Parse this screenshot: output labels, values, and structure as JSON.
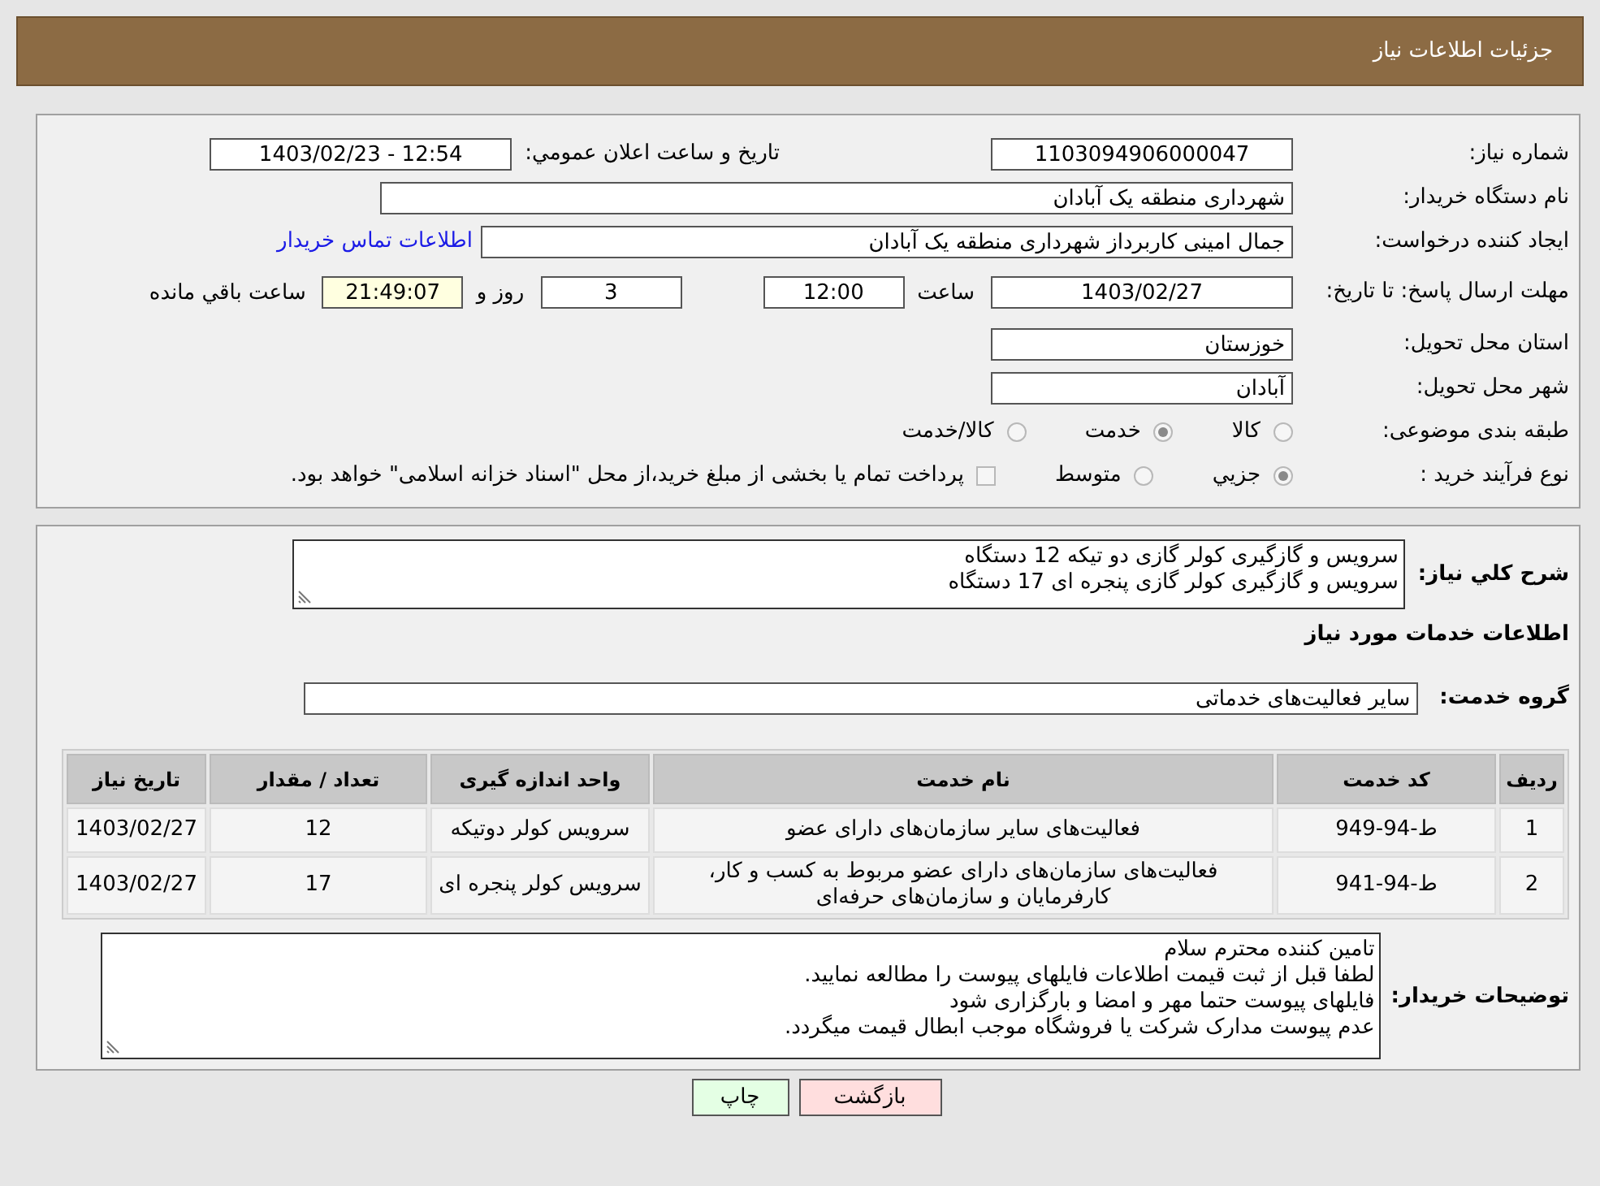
{
  "header": {
    "title": "جزئیات اطلاعات نیاز"
  },
  "details": {
    "need_number": {
      "label": "شماره نیاز:",
      "value": "1103094906000047"
    },
    "announce": {
      "label": "تاریخ و ساعت اعلان عمومي:",
      "value": "1403/02/23 - 12:54"
    },
    "buyer": {
      "label": "نام دستگاه خریدار:",
      "value": "شهرداری منطقه یک آبادان"
    },
    "creator": {
      "label": "ایجاد کننده درخواست:",
      "value": "جمال امینی کاربرداز شهرداری منطقه یک آبادان",
      "link": "اطلاعات تماس خریدار"
    },
    "deadline": {
      "label": "مهلت ارسال پاسخ: تا تاریخ:",
      "date": "1403/02/27",
      "time_label": "ساعت",
      "time": "12:00",
      "days": "3",
      "days_label": "روز و",
      "remaining": "21:49:07",
      "remaining_label": "ساعت باقي مانده"
    },
    "province": {
      "label": "استان محل تحویل:",
      "value": "خوزستان"
    },
    "city": {
      "label": "شهر محل تحویل:",
      "value": "آبادان"
    },
    "category": {
      "label": "طبقه بندی موضوعی:",
      "options": [
        {
          "label": "کالا",
          "selected": false
        },
        {
          "label": "خدمت",
          "selected": true
        },
        {
          "label": "کالا/خدمت",
          "selected": false
        }
      ]
    },
    "process": {
      "label": "نوع فرآیند خرید :",
      "options": [
        {
          "label": "جزيي",
          "selected": true
        },
        {
          "label": "متوسط",
          "selected": false
        }
      ],
      "treasury": {
        "label": "پرداخت تمام یا بخشی از مبلغ خرید،از محل \"اسناد خزانه اسلامی\" خواهد بود.",
        "checked": false
      }
    }
  },
  "services": {
    "summary": {
      "label": "شرح كلي نياز:",
      "lines": [
        "سرویس و گازگیری کولر گازی دو تیکه 12 دستگاه",
        "سرویس و گازگیری کولر گازی پنجره ای  17 دستگاه"
      ]
    },
    "heading": "اطلاعات خدمات مورد نیاز",
    "group": {
      "label": "گروه خدمت:",
      "value": "سایر فعالیت‌های خدماتی"
    },
    "table": {
      "columns": [
        "ردیف",
        "کد خدمت",
        "نام خدمت",
        "واحد اندازه گیری",
        "تعداد / مقدار",
        "تاریخ نیاز"
      ],
      "rows": [
        [
          "1",
          "ط-94-949",
          "فعالیت‌های سایر سازمان‌های دارای عضو",
          "سرویس کولر دوتیکه",
          "12",
          "1403/02/27"
        ],
        [
          "2",
          "ط-94-941",
          "فعالیت‌های سازمان‌های دارای عضو مربوط به کسب و کار، کارفرمایان و سازمان‌های حرفه‌ای",
          "سرویس کولر پنجره ای",
          "17",
          "1403/02/27"
        ]
      ]
    },
    "buyer_notes": {
      "label": "توضیحات خریدار:",
      "lines": [
        "تامین کننده محترم سلام",
        "لطفا قبل از ثبت قیمت اطلاعات فایلهای پیوست را مطالعه نمایید.",
        "فایلهای پیوست حتما مهر و امضا و بارگزاری شود",
        "عدم پیوست مدارک شرکت یا فروشگاه موجب ابطال قیمت میگردد."
      ]
    }
  },
  "buttons": [
    {
      "kind": "back",
      "label": "بازگشت"
    },
    {
      "kind": "print",
      "label": "چاپ"
    }
  ]
}
